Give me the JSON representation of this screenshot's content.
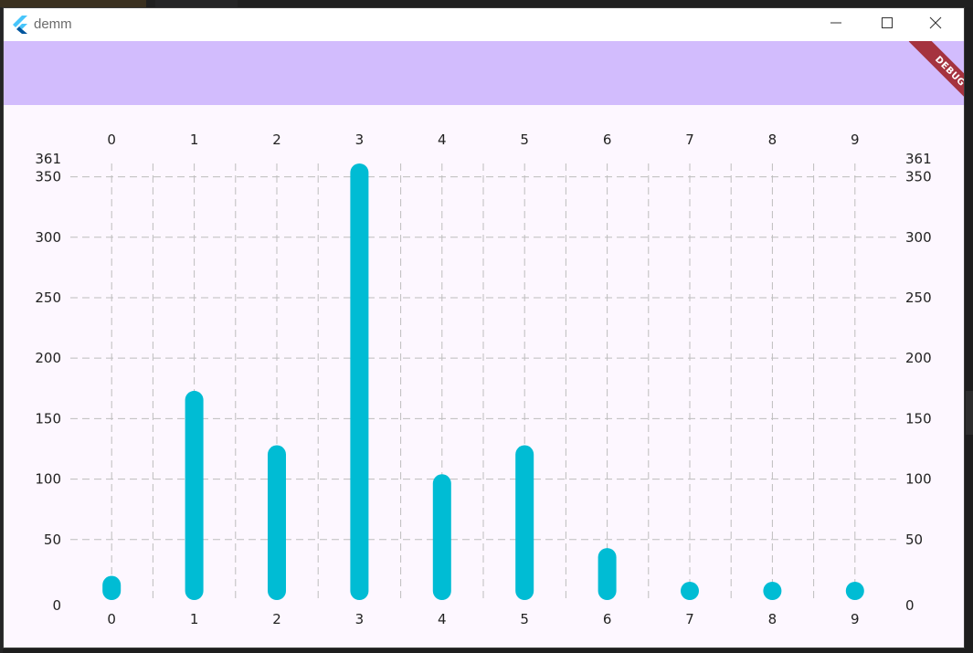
{
  "window": {
    "title": "demm",
    "debug_label": "DEBUG"
  },
  "colors": {
    "appbar": "#d2bcfd",
    "bar": "#00bcd4",
    "grid": "#bdbdbd",
    "debug": "#a5333f",
    "background": "#fdf7ff"
  },
  "icons": {
    "app": "flutter-logo-icon",
    "minimize": "minimize-icon",
    "maximize": "maximize-icon",
    "close": "close-icon"
  },
  "chart_data": {
    "type": "bar",
    "categories": [
      "0",
      "1",
      "2",
      "3",
      "4",
      "5",
      "6",
      "7",
      "8",
      "9"
    ],
    "values": [
      20,
      173,
      128,
      361,
      104,
      128,
      43,
      4,
      4,
      4
    ],
    "ylim": [
      0,
      361
    ],
    "yticks": [
      "0",
      "50",
      "100",
      "150",
      "200",
      "250",
      "300",
      "350",
      "361"
    ],
    "ytick_values": [
      0,
      50,
      100,
      150,
      200,
      250,
      300,
      350,
      361
    ],
    "grid": true,
    "axis_labels_top": true,
    "axis_labels_bottom": true,
    "axis_labels_left": true,
    "axis_labels_right": true
  }
}
